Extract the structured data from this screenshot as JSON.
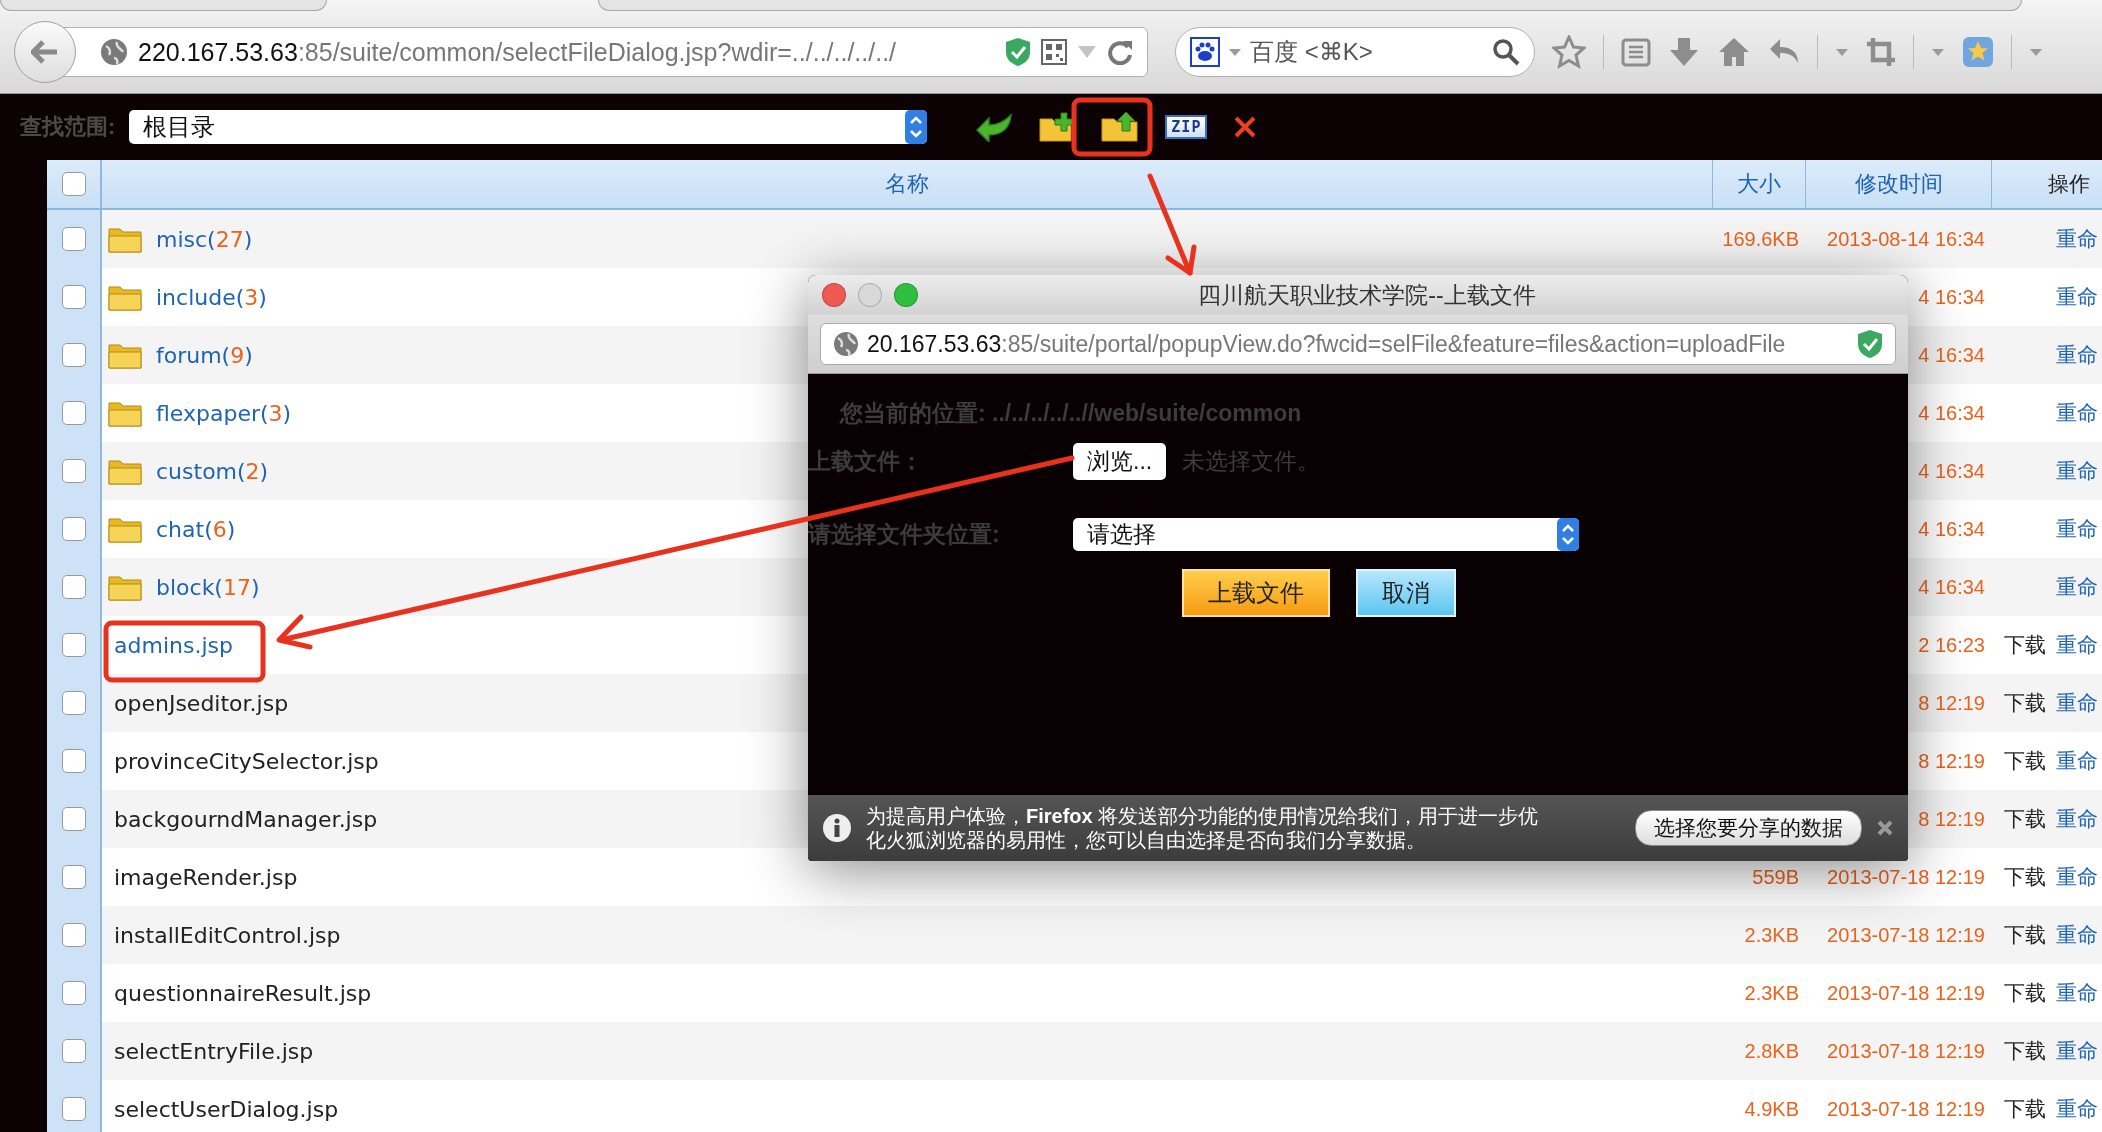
{
  "browser": {
    "url_host": "220.167.53.63",
    "url_path": ":85/suite/common/selectFileDialog.jsp?wdir=../../../../../",
    "search_placeholder": "百度 <⌘K>"
  },
  "toolbar": {
    "scope_label": "查找范围:",
    "scope_value": "根目录",
    "zip_label": "ZIP"
  },
  "table": {
    "all_checked": false,
    "columns": [
      "名称",
      "大小",
      "修改时间",
      "操作"
    ],
    "rows": [
      {
        "kind": "folder",
        "label": "misc(27)",
        "size": "169.6KB",
        "time": "2013-08-14 16:34",
        "rename": "重命",
        "checked": false,
        "active": false
      },
      {
        "kind": "folder",
        "label": "include(3)",
        "time": "4 16:34",
        "rename": "重命",
        "checked": false,
        "active": false
      },
      {
        "kind": "folder",
        "label": "forum(9)",
        "time": "4 16:34",
        "rename": "重命",
        "checked": false,
        "active": false
      },
      {
        "kind": "folder",
        "label": "flexpaper(3)",
        "time": "4 16:34",
        "rename": "重命",
        "checked": false,
        "active": false
      },
      {
        "kind": "folder",
        "label": "custom(2)",
        "time": "4 16:34",
        "rename": "重命",
        "checked": false,
        "active": false
      },
      {
        "kind": "folder",
        "label": "chat(6)",
        "time": "4 16:34",
        "rename": "重命",
        "checked": false,
        "active": false
      },
      {
        "kind": "folder",
        "label": "block(17)",
        "time": "4 16:34",
        "rename": "重命",
        "checked": false,
        "active": false
      },
      {
        "kind": "file",
        "label": "admins.jsp",
        "time": "2 16:23",
        "download": "下载",
        "rename": "重命",
        "checked": false,
        "active": true
      },
      {
        "kind": "file",
        "label": "openJseditor.jsp",
        "time": "8 12:19",
        "download": "下载",
        "rename": "重命",
        "checked": false,
        "active": false
      },
      {
        "kind": "file",
        "label": "provinceCitySelector.jsp",
        "time": "8 12:19",
        "download": "下载",
        "rename": "重命",
        "checked": false,
        "active": false
      },
      {
        "kind": "file",
        "label": "backgourndManager.jsp",
        "time": "8 12:19",
        "download": "下载",
        "rename": "重命",
        "checked": false,
        "active": false
      },
      {
        "kind": "file",
        "label": "imageRender.jsp",
        "size": "559B",
        "time": "2013-07-18 12:19",
        "download": "下载",
        "rename": "重命",
        "checked": false,
        "active": false
      },
      {
        "kind": "file",
        "label": "installEditControl.jsp",
        "size": "2.3KB",
        "time": "2013-07-18 12:19",
        "download": "下载",
        "rename": "重命",
        "checked": false,
        "active": false
      },
      {
        "kind": "file",
        "label": "questionnaireResult.jsp",
        "size": "2.3KB",
        "time": "2013-07-18 12:19",
        "download": "下载",
        "rename": "重命",
        "checked": false,
        "active": false
      },
      {
        "kind": "file",
        "label": "selectEntryFile.jsp",
        "size": "2.8KB",
        "time": "2013-07-18 12:19",
        "download": "下载",
        "rename": "重命",
        "checked": false,
        "active": false
      },
      {
        "kind": "file",
        "label": "selectUserDialog.jsp",
        "size": "4.9KB",
        "time": "2013-07-18 12:19",
        "download": "下载",
        "rename": "重命",
        "checked": false,
        "active": false
      }
    ]
  },
  "popup": {
    "title": "四川航天职业技术学院--上载文件",
    "url_host": "20.167.53.63",
    "url_path": ":85/suite/portal/popupView.do?fwcid=selFile&feature=files&action=uploadFile",
    "location": "您当前的位置: ../../../../..//web/suite/common",
    "file_label": "上载文件：",
    "browse_button": "浏览...",
    "file_status": "未选择文件。",
    "folder_label": "请选择文件夹位置:",
    "folder_value": "请选择",
    "upload_button": "上载文件",
    "cancel_button": "取消",
    "notice": "为提高用户体验，**Firefox** 将发送部分功能的使用情况给我们，用于进一步优化火狐浏览器的易用性，您可以自由选择是否向我们分享数据。",
    "notice_button": "选择您要分享的数据"
  }
}
